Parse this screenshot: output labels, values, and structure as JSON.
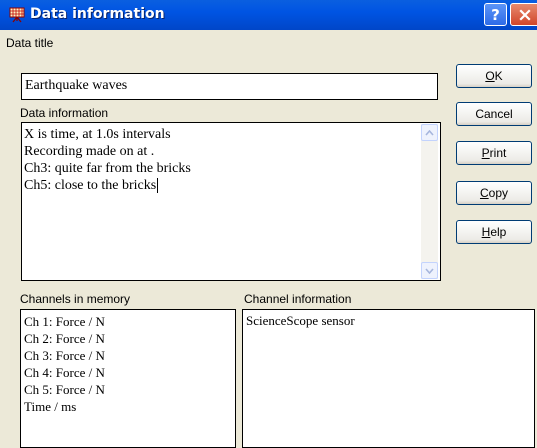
{
  "window": {
    "title": "Data information",
    "help_glyph": "?",
    "close_glyph": "X"
  },
  "data_title": {
    "label": "Data title",
    "value": "Earthquake waves"
  },
  "data_information": {
    "label": "Data information",
    "lines": [
      "X is time, at 1.0s intervals",
      "Recording made on  at .",
      "Ch3: quite far from the bricks",
      "Ch5: close to the bricks"
    ]
  },
  "channels": {
    "label": "Channels in memory",
    "items": [
      "Ch 1: Force / N",
      "Ch 2: Force / N",
      "Ch 3: Force / N",
      "Ch 4: Force / N",
      "Ch 5: Force / N",
      "Time / ms"
    ]
  },
  "channel_information": {
    "label": "Channel information",
    "value": "ScienceScope sensor"
  },
  "buttons": {
    "ok": {
      "mnemonic": "O",
      "rest": "K"
    },
    "cancel": {
      "label": "Cancel"
    },
    "print": {
      "mnemonic": "P",
      "rest": "rint"
    },
    "copy": {
      "mnemonic": "C",
      "rest": "opy"
    },
    "help": {
      "mnemonic": "H",
      "rest": "elp"
    }
  },
  "colors": {
    "titlebar": "#0054E3",
    "dialog_background": "#ECE9D8",
    "close_button": "#D2462A"
  },
  "icons": {
    "app": "grid-chart-icon",
    "help": "question-icon",
    "close": "close-icon",
    "scroll_up": "arrow-up-icon",
    "scroll_down": "arrow-down-icon"
  }
}
